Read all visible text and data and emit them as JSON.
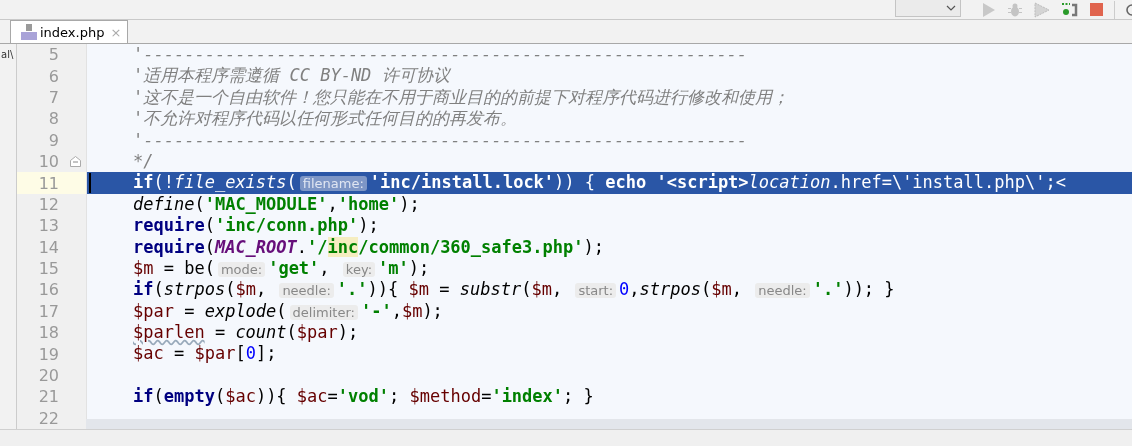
{
  "side_panel": {
    "text": "al\\"
  },
  "tabs": [
    {
      "label": "index.php",
      "selected": true,
      "close": "×"
    }
  ],
  "editor": {
    "lines": [
      {
        "number": "5",
        "selected": false,
        "fold": false,
        "tokens": [
          {
            "kind": "comment",
            "text": "'-----------------------------------------------------------"
          }
        ]
      },
      {
        "number": "6",
        "selected": false,
        "fold": false,
        "tokens": [
          {
            "kind": "comment",
            "text": "'适用本程序需遵循 CC BY-ND 许可协议"
          }
        ]
      },
      {
        "number": "7",
        "selected": false,
        "fold": false,
        "tokens": [
          {
            "kind": "comment",
            "text": "'这不是一个自由软件！您只能在不用于商业目的的前提下对程序代码进行修改和使用；"
          }
        ]
      },
      {
        "number": "8",
        "selected": false,
        "fold": false,
        "tokens": [
          {
            "kind": "comment",
            "text": "'不允许对程序代码以任何形式任何目的的再发布。"
          }
        ]
      },
      {
        "number": "9",
        "selected": false,
        "fold": false,
        "tokens": [
          {
            "kind": "comment",
            "text": "'-----------------------------------------------------------"
          }
        ]
      },
      {
        "number": "10",
        "selected": false,
        "fold": true,
        "tokens": [
          {
            "kind": "comment",
            "text": "*/"
          }
        ]
      },
      {
        "number": "11",
        "selected": true,
        "fold": false,
        "tokens": [
          {
            "kind": "keyword",
            "text": "if"
          },
          {
            "kind": "plain",
            "text": "(!"
          },
          {
            "kind": "function",
            "text": "file_exists"
          },
          {
            "kind": "plain",
            "text": "("
          },
          {
            "kind": "hint",
            "text": "filename:"
          },
          {
            "kind": "string",
            "text": "'inc/install.lock'"
          },
          {
            "kind": "plain",
            "text": ")) { "
          },
          {
            "kind": "keyword",
            "text": "echo "
          },
          {
            "kind": "string",
            "text": "'<script>"
          },
          {
            "kind": "function",
            "text": "location"
          },
          {
            "kind": "plain",
            "text": ".href=\\'install.php\\';<"
          }
        ]
      },
      {
        "number": "12",
        "selected": false,
        "fold": false,
        "tokens": [
          {
            "kind": "function",
            "text": "define"
          },
          {
            "kind": "plain",
            "text": "("
          },
          {
            "kind": "string",
            "text": "'MAC_MODULE'"
          },
          {
            "kind": "plain",
            "text": ","
          },
          {
            "kind": "string",
            "text": "'home'"
          },
          {
            "kind": "plain",
            "text": ");"
          }
        ]
      },
      {
        "number": "13",
        "selected": false,
        "fold": false,
        "tokens": [
          {
            "kind": "keyword",
            "text": "require"
          },
          {
            "kind": "plain",
            "text": "("
          },
          {
            "kind": "string",
            "text": "'inc/conn.php'"
          },
          {
            "kind": "plain",
            "text": ");"
          }
        ]
      },
      {
        "number": "14",
        "selected": false,
        "fold": false,
        "tokens": [
          {
            "kind": "keyword",
            "text": "require"
          },
          {
            "kind": "plain",
            "text": "("
          },
          {
            "kind": "constant",
            "text": "MAC_ROOT"
          },
          {
            "kind": "plain",
            "text": "."
          },
          {
            "kind": "string",
            "text": "'/"
          },
          {
            "kind": "string_marked",
            "text": "inc"
          },
          {
            "kind": "string",
            "text": "/common/360_safe3.php'"
          },
          {
            "kind": "plain",
            "text": ");"
          }
        ]
      },
      {
        "number": "15",
        "selected": false,
        "fold": false,
        "tokens": [
          {
            "kind": "variable",
            "text": "$m"
          },
          {
            "kind": "plain",
            "text": " = be("
          },
          {
            "kind": "hint",
            "text": "mode:"
          },
          {
            "kind": "string",
            "text": "'get'"
          },
          {
            "kind": "plain",
            "text": ", "
          },
          {
            "kind": "hint",
            "text": "key:"
          },
          {
            "kind": "string",
            "text": "'m'"
          },
          {
            "kind": "plain",
            "text": ");"
          }
        ]
      },
      {
        "number": "16",
        "selected": false,
        "fold": false,
        "tokens": [
          {
            "kind": "keyword",
            "text": "if"
          },
          {
            "kind": "plain",
            "text": "("
          },
          {
            "kind": "function",
            "text": "strpos"
          },
          {
            "kind": "plain",
            "text": "("
          },
          {
            "kind": "variable",
            "text": "$m"
          },
          {
            "kind": "plain",
            "text": ", "
          },
          {
            "kind": "hint",
            "text": "needle:"
          },
          {
            "kind": "string",
            "text": "'.'"
          },
          {
            "kind": "plain",
            "text": ")){ "
          },
          {
            "kind": "variable",
            "text": "$m"
          },
          {
            "kind": "plain",
            "text": " = "
          },
          {
            "kind": "function",
            "text": "substr"
          },
          {
            "kind": "plain",
            "text": "("
          },
          {
            "kind": "variable",
            "text": "$m"
          },
          {
            "kind": "plain",
            "text": ", "
          },
          {
            "kind": "hint",
            "text": "start:"
          },
          {
            "kind": "number",
            "text": "0"
          },
          {
            "kind": "plain",
            "text": ","
          },
          {
            "kind": "function",
            "text": "strpos"
          },
          {
            "kind": "plain",
            "text": "("
          },
          {
            "kind": "variable",
            "text": "$m"
          },
          {
            "kind": "plain",
            "text": ", "
          },
          {
            "kind": "hint",
            "text": "needle:"
          },
          {
            "kind": "string",
            "text": "'.'"
          },
          {
            "kind": "plain",
            "text": ")); }"
          }
        ]
      },
      {
        "number": "17",
        "selected": false,
        "fold": false,
        "tokens": [
          {
            "kind": "variable",
            "text": "$par"
          },
          {
            "kind": "plain",
            "text": " = "
          },
          {
            "kind": "function",
            "text": "explode"
          },
          {
            "kind": "plain",
            "text": "("
          },
          {
            "kind": "hint",
            "text": "delimiter:"
          },
          {
            "kind": "string",
            "text": "'-'"
          },
          {
            "kind": "plain",
            "text": ","
          },
          {
            "kind": "variable",
            "text": "$m"
          },
          {
            "kind": "plain",
            "text": ");"
          }
        ]
      },
      {
        "number": "18",
        "selected": false,
        "fold": false,
        "tokens": [
          {
            "kind": "variable_typo",
            "text": "$parlen"
          },
          {
            "kind": "plain",
            "text": " = "
          },
          {
            "kind": "function",
            "text": "count"
          },
          {
            "kind": "plain",
            "text": "("
          },
          {
            "kind": "variable",
            "text": "$par"
          },
          {
            "kind": "plain",
            "text": ");"
          }
        ]
      },
      {
        "number": "19",
        "selected": false,
        "fold": false,
        "tokens": [
          {
            "kind": "variable",
            "text": "$ac"
          },
          {
            "kind": "plain",
            "text": " = "
          },
          {
            "kind": "variable",
            "text": "$par"
          },
          {
            "kind": "plain",
            "text": "["
          },
          {
            "kind": "number",
            "text": "0"
          },
          {
            "kind": "plain",
            "text": "];"
          }
        ]
      },
      {
        "number": "20",
        "selected": false,
        "fold": false
      },
      {
        "number": "21",
        "selected": false,
        "fold": false,
        "tokens": [
          {
            "kind": "keyword",
            "text": "if"
          },
          {
            "kind": "plain",
            "text": "("
          },
          {
            "kind": "keyword",
            "text": "empty"
          },
          {
            "kind": "plain",
            "text": "("
          },
          {
            "kind": "variable",
            "text": "$ac"
          },
          {
            "kind": "plain",
            "text": ")){ "
          },
          {
            "kind": "variable",
            "text": "$ac"
          },
          {
            "kind": "plain",
            "text": "="
          },
          {
            "kind": "string",
            "text": "'vod'"
          },
          {
            "kind": "plain",
            "text": "; "
          },
          {
            "kind": "variable",
            "text": "$method"
          },
          {
            "kind": "plain",
            "text": "="
          },
          {
            "kind": "string",
            "text": "'index'"
          },
          {
            "kind": "plain",
            "text": "; }"
          }
        ]
      },
      {
        "number": "22",
        "selected": false,
        "fold": false
      }
    ]
  }
}
